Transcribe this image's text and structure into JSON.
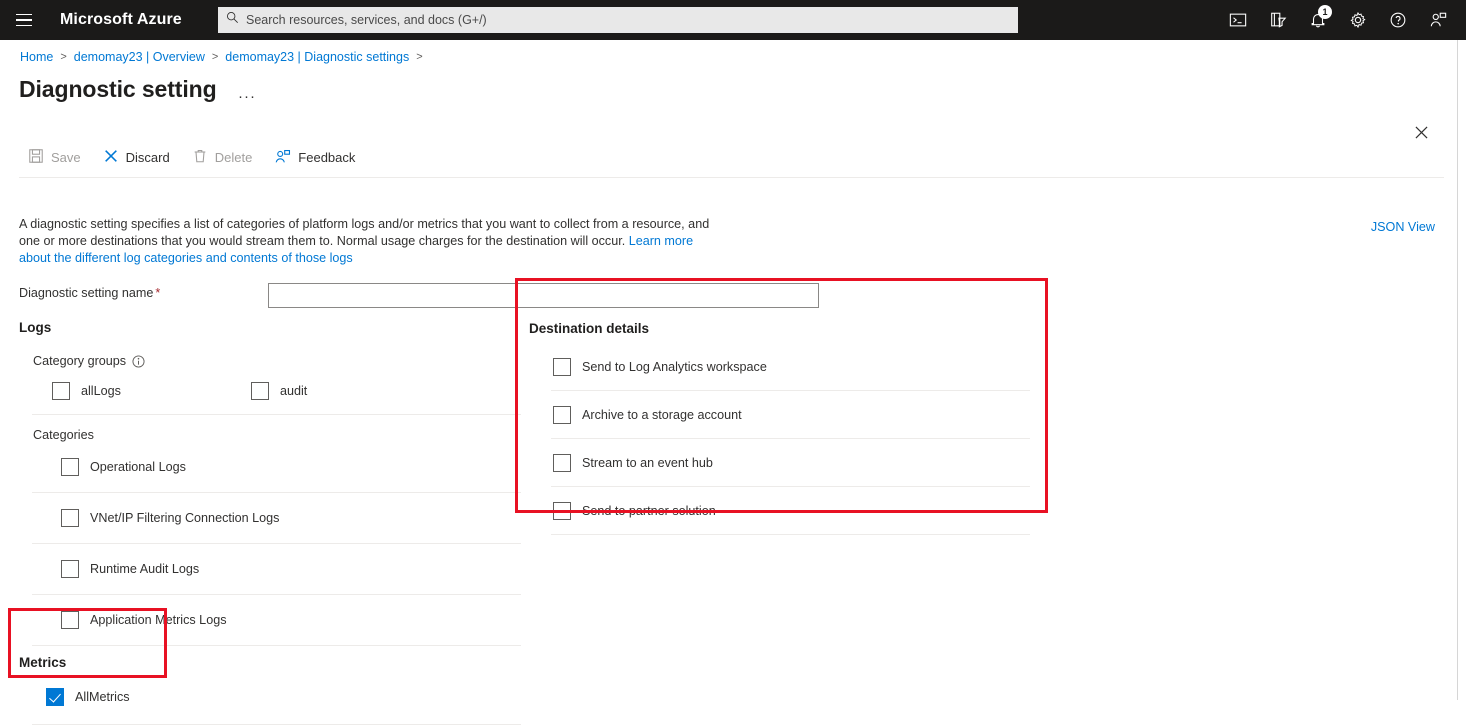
{
  "topbar": {
    "menu_label": "Show portal menu",
    "brand": "Microsoft Azure",
    "search_placeholder": "Search resources, services, and docs (G+/)",
    "search_value": "",
    "icons": [
      {
        "name": "cloud-shell-icon",
        "title": "Cloud Shell"
      },
      {
        "name": "directories-subscriptions-icon",
        "title": "Directories + subscriptions"
      },
      {
        "name": "notifications-bell-icon",
        "title": "Notifications",
        "badge": "1"
      },
      {
        "name": "settings-gear-icon",
        "title": "Settings"
      },
      {
        "name": "help-question-icon",
        "title": "Help"
      },
      {
        "name": "feedback-person-icon",
        "title": "Feedback"
      }
    ]
  },
  "breadcrumb": {
    "items": [
      "Home",
      "demomay23 | Overview",
      "demomay23 | Diagnostic settings"
    ],
    "separator": ">"
  },
  "page": {
    "title": "Diagnostic setting",
    "more_menu": "···",
    "close_label": "Close"
  },
  "toolbar": {
    "buttons": [
      {
        "label": "Save",
        "icon": "save-disk-icon",
        "disabled": true
      },
      {
        "label": "Discard",
        "icon": "discard-x-icon",
        "disabled": false
      },
      {
        "label": "Delete",
        "icon": "delete-trash-icon",
        "disabled": true
      },
      {
        "label": "Feedback",
        "icon": "feedback-person-icon",
        "disabled": false
      }
    ]
  },
  "description": {
    "text": "A diagnostic setting specifies a list of categories of platform logs and/or metrics that you want to collect from a resource, and one or more destinations that you would stream them to. Normal usage charges for the destination will occur. ",
    "link_text": "Learn more about the different log categories and contents of those logs",
    "json_view": "JSON View"
  },
  "name_field": {
    "label": "Diagnostic setting name",
    "required_marker": "*",
    "value": "",
    "placeholder": ""
  },
  "logs": {
    "section_title": "Logs",
    "category_groups_label": "Category groups",
    "category_groups_info": "info-icon",
    "category_groups": [
      {
        "label": "allLogs",
        "checked": false
      },
      {
        "label": "audit",
        "checked": false
      }
    ],
    "categories_label": "Categories",
    "categories": [
      {
        "label": "Operational Logs",
        "checked": false
      },
      {
        "label": "VNet/IP Filtering Connection Logs",
        "checked": false
      },
      {
        "label": "Runtime Audit Logs",
        "checked": false
      },
      {
        "label": "Application Metrics Logs",
        "checked": false
      }
    ]
  },
  "metrics": {
    "section_title": "Metrics",
    "items": [
      {
        "label": "AllMetrics",
        "checked": true
      }
    ]
  },
  "destination": {
    "section_title": "Destination details",
    "options": [
      {
        "label": "Send to Log Analytics workspace",
        "checked": false
      },
      {
        "label": "Archive to a storage account",
        "checked": false
      },
      {
        "label": "Stream to an event hub",
        "checked": false
      },
      {
        "label": "Send to partner solution",
        "checked": false
      }
    ]
  },
  "annotations": {
    "highlight_color": "#e81123",
    "boxes": [
      "destination-details-highlight",
      "metrics-highlight"
    ]
  },
  "colors": {
    "topbar_bg": "#1b1a19",
    "accent_blue": "#0078d4",
    "required_red": "#a4262c",
    "highlight_red": "#e81123"
  }
}
